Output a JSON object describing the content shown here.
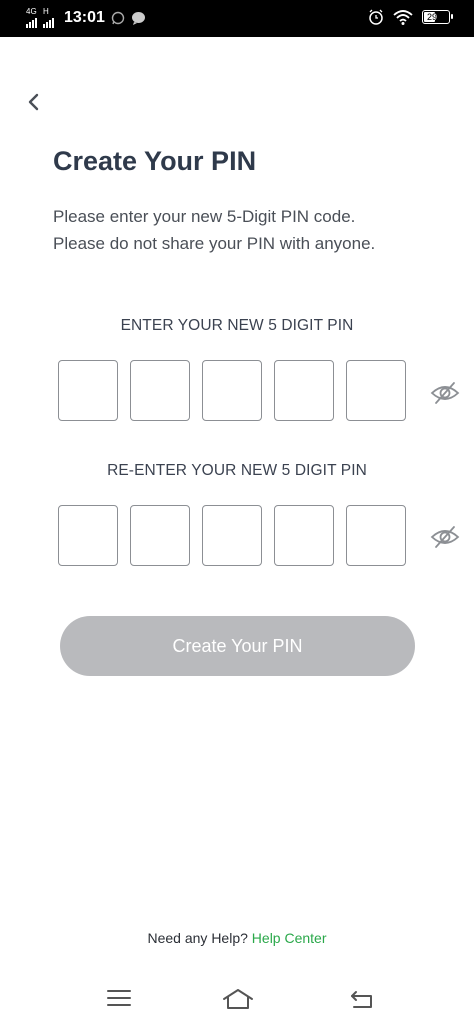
{
  "status_bar": {
    "network_top": "4G",
    "network_h": "H",
    "time": "13:01",
    "battery": "29"
  },
  "header": {
    "title": "Create Your PIN",
    "subtitle_line1": "Please enter your new 5-Digit PIN code.",
    "subtitle_line2": "Please do not share your PIN with anyone."
  },
  "pin_entry": {
    "label": "ENTER YOUR NEW 5 DIGIT PIN",
    "digits": [
      "",
      "",
      "",
      "",
      ""
    ]
  },
  "pin_confirm": {
    "label": "RE-ENTER YOUR NEW 5 DIGIT PIN",
    "digits": [
      "",
      "",
      "",
      "",
      ""
    ]
  },
  "cta": {
    "label": "Create Your PIN"
  },
  "help": {
    "prefix": "Need any Help?",
    "link": "Help Center"
  },
  "colors": {
    "accent_link": "#2aa84a",
    "button_disabled": "#b9babd",
    "title": "#2f3a4b"
  }
}
